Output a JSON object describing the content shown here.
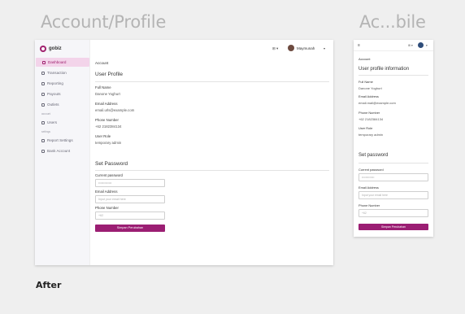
{
  "headings": {
    "desktop": "Account/Profile",
    "mobile": "Ac...bile",
    "after": "After"
  },
  "brand": {
    "name": "gobiz",
    "accent": "#9b1e73"
  },
  "sidebar": {
    "items": [
      {
        "label": "Dashboard",
        "icon": "dashboard-icon",
        "active": true
      },
      {
        "label": "Transaction",
        "icon": "transaction-icon"
      },
      {
        "label": "Reporting",
        "icon": "reporting-icon"
      },
      {
        "label": "Payouts",
        "icon": "payouts-icon"
      },
      {
        "label": "Outlets",
        "icon": "outlets-icon"
      }
    ],
    "section_account": "account",
    "account_items": [
      {
        "label": "Users",
        "icon": "users-icon"
      }
    ],
    "section_settings": "settings",
    "settings_items": [
      {
        "label": "Report Settings",
        "icon": "settings-icon"
      },
      {
        "label": "Bank Account",
        "icon": "bank-icon"
      }
    ]
  },
  "topbar": {
    "language": "⊞ ▾",
    "user_name": "Maymunah",
    "caret": "▾"
  },
  "content": {
    "breadcrumb": "Account",
    "profile_title": "User Profile",
    "fields": [
      {
        "label": "Full Name",
        "value": "Danone Yoghurt"
      },
      {
        "label": "Email Address",
        "value": "email.urls@example.com"
      },
      {
        "label": "Phone Number",
        "value": "+62 2182384134"
      },
      {
        "label": "User Role",
        "value": "temporary admin"
      }
    ],
    "password_title": "Set Password",
    "password_form": [
      {
        "label": "Current password",
        "placeholder": "•••••••••••••"
      },
      {
        "label": "Email Address",
        "placeholder": "Input your email here"
      },
      {
        "label": "Phone Number",
        "placeholder": "+62"
      }
    ],
    "save_label": "Simpan Perubahan"
  },
  "mobile": {
    "menu_icon": "≡",
    "language": "⊞ ▾",
    "caret": "▾",
    "breadcrumb": "Account",
    "profile_title": "User profile information",
    "fields": [
      {
        "label": "Full Name",
        "value": "Danone Yoghurt"
      },
      {
        "label": "Email Address",
        "value": "email.mail@example.com"
      },
      {
        "label": "Phone Number",
        "value": "+62 2182384134"
      },
      {
        "label": "User Role",
        "value": "temporary admin"
      }
    ],
    "password_title": "Set password",
    "password_form": [
      {
        "label": "Current password",
        "placeholder": "•••••••••••••"
      },
      {
        "label": "Email Address",
        "placeholder": "Input your email here"
      },
      {
        "label": "Phone Number",
        "placeholder": "+62"
      }
    ],
    "save_label": "Simpan Perubahan"
  }
}
